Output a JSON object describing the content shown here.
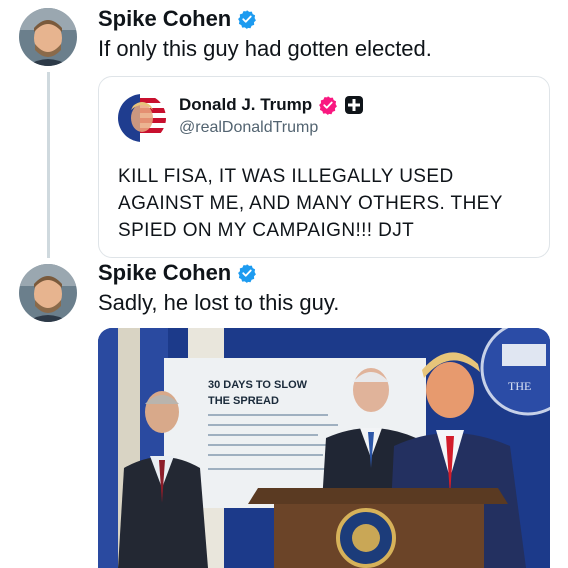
{
  "tweet1": {
    "author": "Spike Cohen",
    "text": "If only this guy had gotten elected."
  },
  "quoted": {
    "author": "Donald J. Trump",
    "handle": "@realDonaldTrump",
    "lines": [
      "KILL FISA, IT WAS ILLEGALLY USED",
      "AGAINST ME, AND MANY OTHERS. THEY",
      "SPIED ON MY CAMPAIGN!!! DJT"
    ]
  },
  "tweet2": {
    "author": "Spike Cohen",
    "text": "Sadly, he lost to this guy.",
    "media": {
      "screen_title_line1": "30 DAYS TO SLOW",
      "screen_title_line2": "THE SPREAD",
      "logo_text": "THE"
    }
  },
  "colors": {
    "verified_blue": "#1d9bf0",
    "verified_pink": "#f91880",
    "backdrop_blue": "#1c3a8a"
  }
}
